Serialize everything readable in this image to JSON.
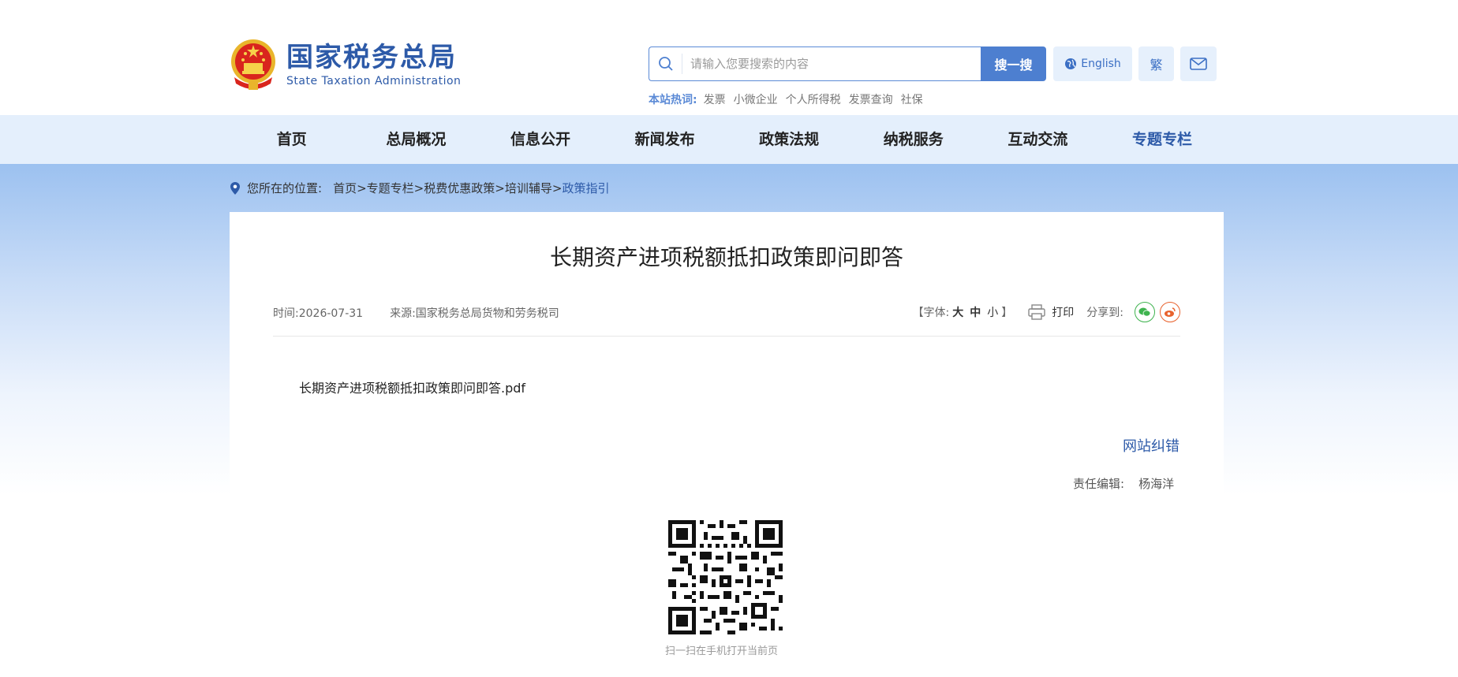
{
  "header": {
    "logo_cn": "国家税务总局",
    "logo_en": "State Taxation Administration",
    "search_placeholder": "请输入您要搜索的内容",
    "search_button": "搜一搜",
    "english_button": "English",
    "traditional_button": "繁",
    "hot_label": "本站热词:",
    "hot_words": [
      "发票",
      "小微企业",
      "个人所得税",
      "发票查询",
      "社保"
    ]
  },
  "nav": {
    "items": [
      "首页",
      "总局概况",
      "信息公开",
      "新闻发布",
      "政策法规",
      "纳税服务",
      "互动交流",
      "专题专栏"
    ],
    "active_index": 7
  },
  "breadcrumb": {
    "label": "您所在的位置:",
    "items": [
      "首页",
      "专题专栏",
      "税费优惠政策",
      "培训辅导"
    ],
    "current": "政策指引"
  },
  "article": {
    "title": "长期资产进项税额抵扣政策即问即答",
    "time": "时间:2026-07-31",
    "source": "来源:国家税务总局货物和劳务税司",
    "font_label": "【字体:",
    "font_large": "大",
    "font_medium": "中",
    "font_small": "小",
    "font_close": "】",
    "print_label": "打印",
    "share_label": "分享到:",
    "attachment": "长期资产进项税额抵扣政策即问即答.pdf",
    "correction_link": "网站纠错",
    "editor_label": "责任编辑:",
    "editor_name": "杨海洋",
    "qr_caption": "扫一扫在手机打开当前页"
  },
  "colors": {
    "brand": "#2d5aa8",
    "button": "#4d7fd0",
    "nav_bg": "#e4effc"
  }
}
